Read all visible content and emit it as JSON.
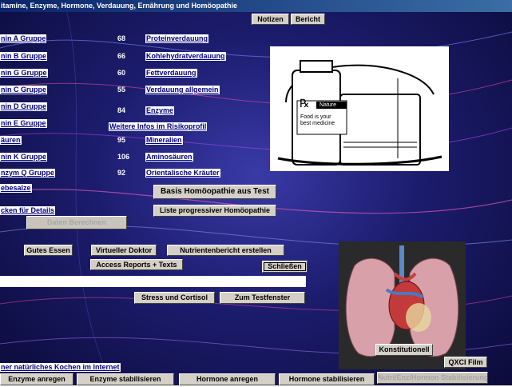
{
  "window": {
    "title": "itamine, Enzyme, Hormone, Verdauung, Ernährung und Homöopathie"
  },
  "top_buttons": {
    "notes": "Notizen",
    "report": "Bericht"
  },
  "vitamins": [
    {
      "label": "nin A Gruppe",
      "value": "68",
      "link": "Proteinverdauung"
    },
    {
      "label": "nin B Gruppe",
      "value": "66",
      "link": "Kohlehydratverdauung"
    },
    {
      "label": "nin G Gruppe",
      "value": "60",
      "link": "Fettverdauung"
    },
    {
      "label": "nin C Gruppe",
      "value": "55",
      "link": "Verdauung allgemein"
    },
    {
      "label": "nin D Gruppe",
      "value": "84",
      "link": "Enzyme"
    },
    {
      "label": "nin E Gruppe",
      "value": "",
      "link": "Weitere Infos im Risikoprofil"
    },
    {
      "label": "äuren",
      "value": "95",
      "link": "Mineralien"
    },
    {
      "label": "nin K Gruppe",
      "value": "106",
      "link": "Aminosäuren"
    },
    {
      "label": "nzym Q Gruppe",
      "value": "92",
      "link": "Orientalische Kräuter"
    },
    {
      "label": "ebesalze",
      "value": "",
      "link": ""
    }
  ],
  "details_label": "cken für Details",
  "buttons": {
    "compute": "Daten Berechnen",
    "basis_homeo": "Basis Homöopathie aus Test",
    "progressive_homeo": "Liste progressiver Homöopathie",
    "good_food": "Gutes Essen",
    "virtual_doctor": "Virtueller Doktor",
    "nutrient_report": "Nutrientenbericht erstellen",
    "access_reports": "Access Reports + Texts",
    "close": "Schließen",
    "stress": "Stress und Cortisol",
    "test_window": "Zum Testfenster",
    "constitutional": "Konstitutionell",
    "qxci_film": "QXCI Film"
  },
  "image_text": {
    "badge": "Nature",
    "caption": "Food is your best medicine",
    "rx": "℞"
  },
  "input_value": "",
  "cooking_label": "ner natürliches Kochen im Internet",
  "bottom_buttons": {
    "enzyme_stimulate": "Enzyme anregen",
    "enzyme_stabilize": "Enzyme stabilisieren",
    "hormone_stimulate": "Hormone anregen",
    "hormone_stabilize": "Hormone stabilisieren",
    "nutri_stabilize": "Nutri/Enz/Hormon Stabilisierung"
  }
}
